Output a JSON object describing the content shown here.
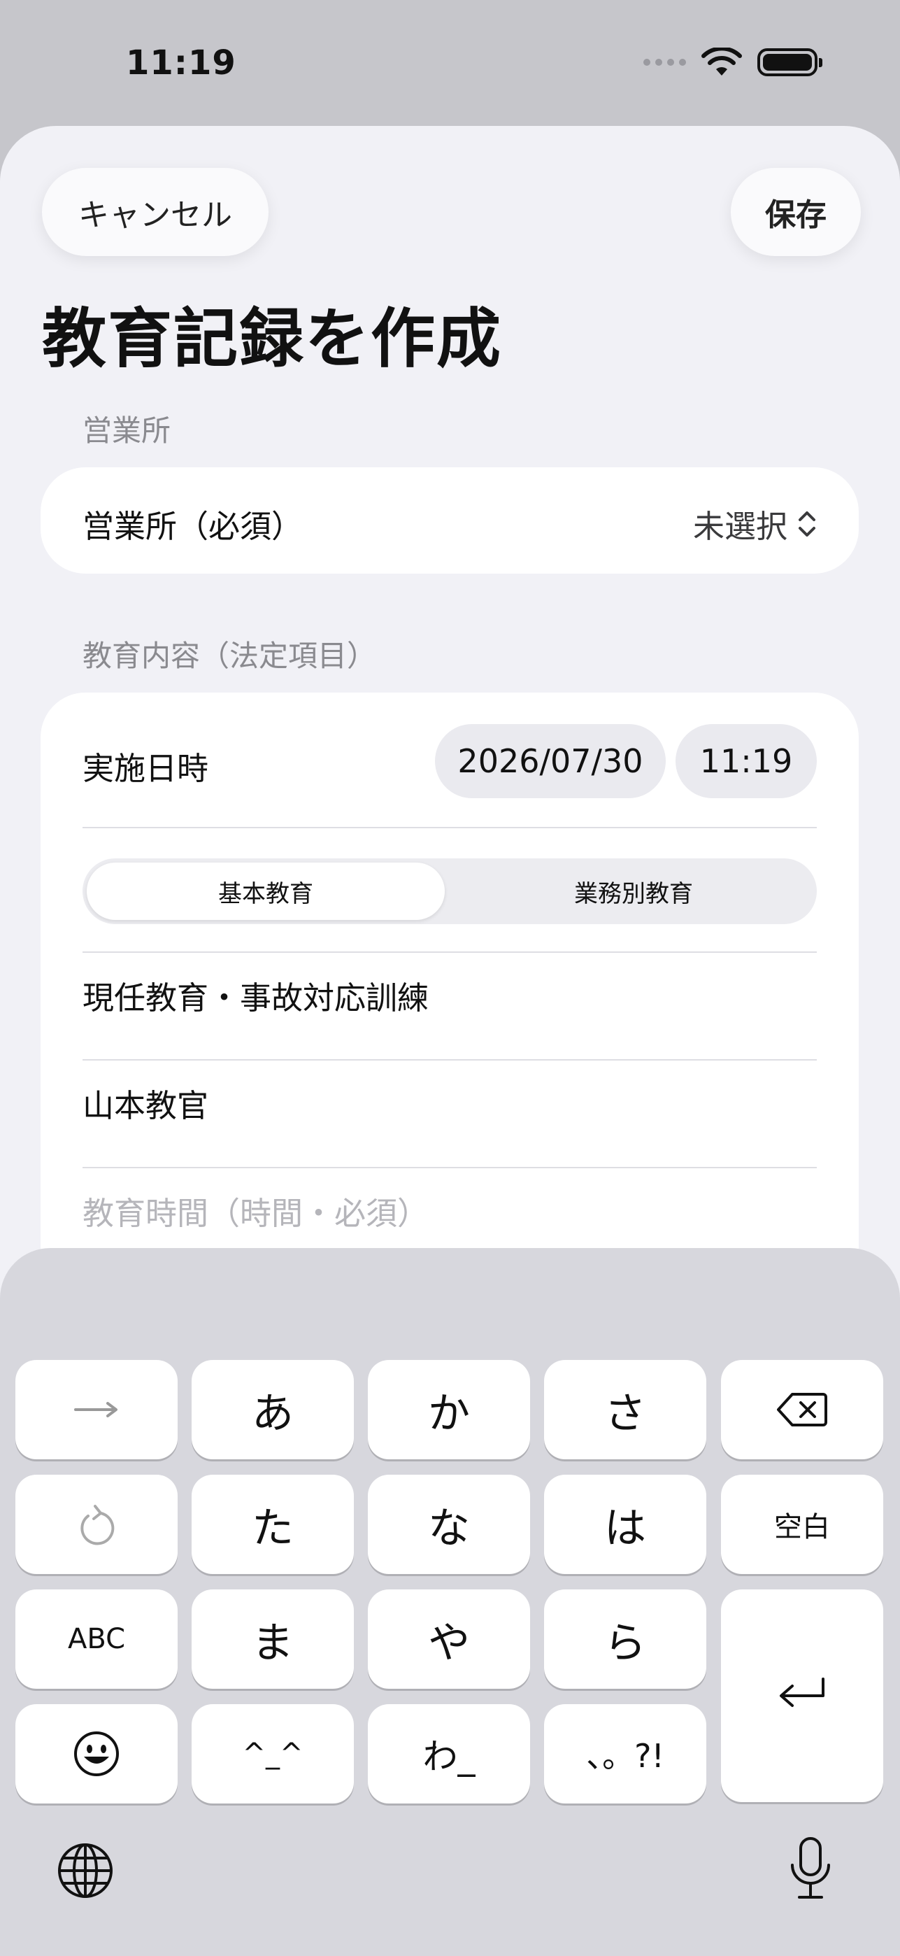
{
  "status_bar": {
    "time": "11:19"
  },
  "nav": {
    "cancel_label": "キャンセル",
    "save_label": "保存",
    "title": "教育記録を作成"
  },
  "office_section": {
    "header": "営業所",
    "row_label": "営業所（必須）",
    "value": "未選択"
  },
  "content_section": {
    "header": "教育内容（法定項目）",
    "datetime_label": "実施日時",
    "date": "2026/07/30",
    "time": "11:19",
    "segments": [
      "基本教育",
      "業務別教育"
    ],
    "selected_segment": "基本教育",
    "topic": "現任教育・事故対応訓練",
    "instructor": "山本教官",
    "hours_placeholder": "教育時間（時間・必須）"
  },
  "keyboard": {
    "row1": [
      "→",
      "あ",
      "か",
      "さ"
    ],
    "row2": [
      "た",
      "な",
      "は",
      "空白"
    ],
    "row3": [
      "ABC",
      "ま",
      "や",
      "ら"
    ],
    "row4": [
      "^_^",
      "わ_",
      "、。?!"
    ],
    "icons": [
      "arrow-right-icon",
      "delete-icon",
      "undo-icon",
      "return-icon",
      "emoji-icon",
      "globe-icon",
      "microphone-icon"
    ]
  }
}
